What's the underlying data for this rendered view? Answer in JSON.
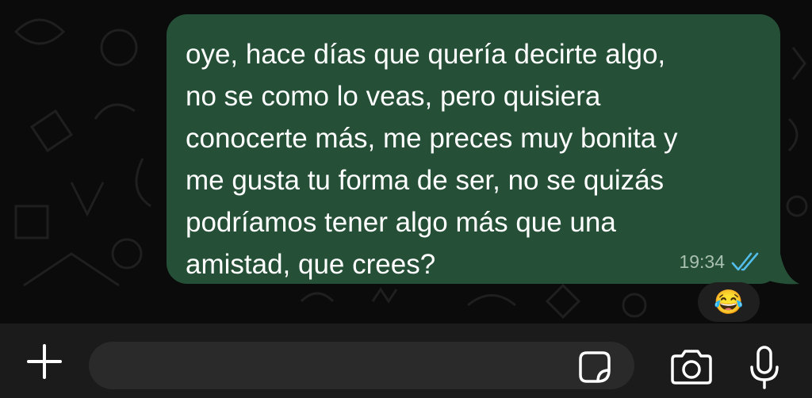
{
  "message": {
    "lines": [
      "oye, hace días que quería decirte algo,",
      "no se como lo veas, pero quisiera",
      "conocerte más, me preces muy bonita y",
      "me gusta tu forma de ser, no se quizás",
      "podríamos tener algo más que una",
      "amistad, que crees?"
    ],
    "time": "19:34",
    "status": "read",
    "reaction": "😂"
  },
  "input_bar": {
    "placeholder": "",
    "icons": [
      "plus-icon",
      "sticker-icon",
      "camera-icon",
      "microphone-icon"
    ]
  },
  "colors": {
    "background": "#0b0b0b",
    "bubble": "#255037",
    "read_ticks": "#53bdeb",
    "input_bar": "#1b1b1b",
    "input_field": "#2a2a2a"
  }
}
